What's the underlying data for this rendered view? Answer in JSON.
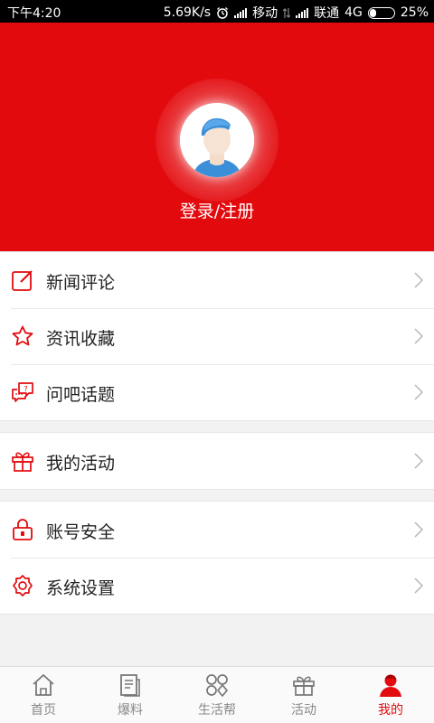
{
  "status_bar": {
    "time": "下午4:20",
    "speed": "5.69K/s",
    "carrier1": "移动",
    "carrier2": "联通",
    "network": "4G",
    "battery": "25%",
    "battery_level": 0.25
  },
  "profile": {
    "login_label": "登录/注册",
    "header_color": "#e30a0e"
  },
  "menu_groups": [
    [
      {
        "label": "新闻评论",
        "icon": "edit-icon"
      },
      {
        "label": "资讯收藏",
        "icon": "star-icon"
      },
      {
        "label": "问吧话题",
        "icon": "question-chat-icon"
      }
    ],
    [
      {
        "label": "我的活动",
        "icon": "gift-icon"
      }
    ],
    [
      {
        "label": "账号安全",
        "icon": "lock-icon"
      },
      {
        "label": "系统设置",
        "icon": "settings-icon"
      }
    ]
  ],
  "tabs": [
    {
      "label": "首页",
      "icon": "home-icon"
    },
    {
      "label": "爆料",
      "icon": "document-icon"
    },
    {
      "label": "生活帮",
      "icon": "apps-icon"
    },
    {
      "label": "活动",
      "icon": "gift-icon"
    },
    {
      "label": "我的",
      "icon": "user-icon",
      "active": true
    }
  ],
  "accent_color": "#e30a0e"
}
